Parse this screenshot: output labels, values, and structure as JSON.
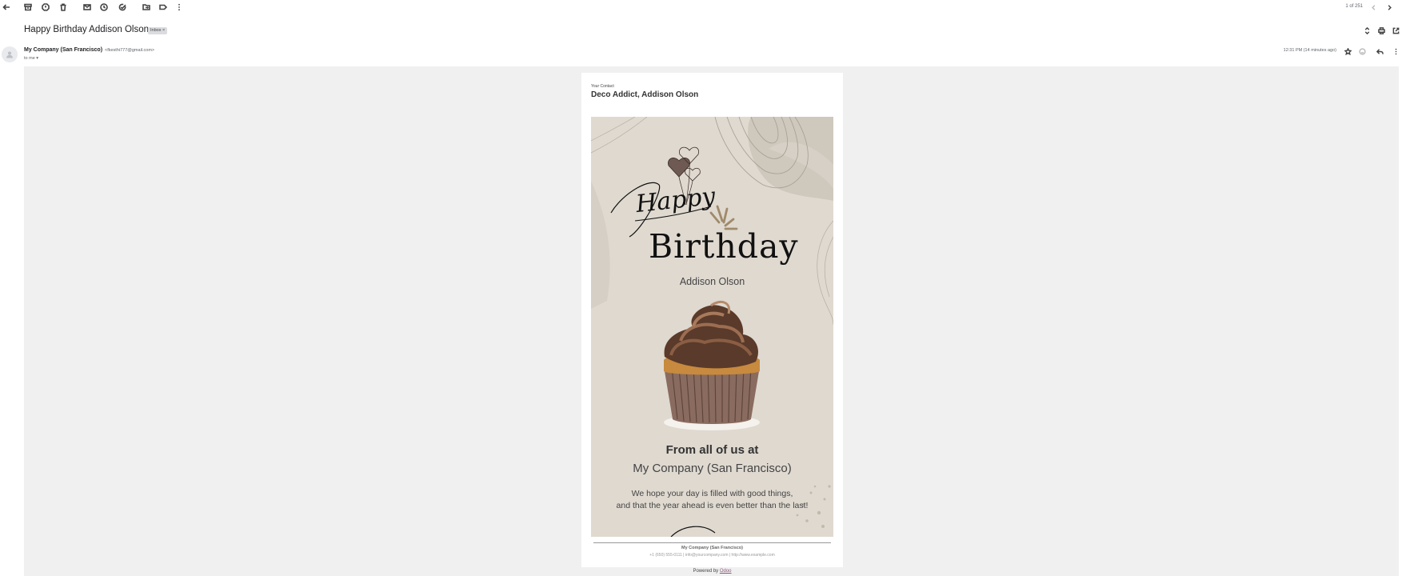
{
  "toolbar": {
    "icons": [
      "back-arrow-icon",
      "archive-icon",
      "report-spam-icon",
      "delete-icon",
      "mark-unread-icon",
      "snooze-icon",
      "add-task-icon",
      "move-to-icon",
      "label-icon",
      "more-vert-icon"
    ],
    "pager_text": "1 of 251"
  },
  "message": {
    "subject": "Happy Birthday Addison Olson",
    "label": "Inbox ×",
    "sender_name": "My Company (San Francisco)",
    "sender_email": "<fkesthi777@gmail.com>",
    "recipient": "to me ▾",
    "timestamp": "12:31 PM (14 minutes ago)"
  },
  "email": {
    "your_contact_label": "Your Contact",
    "contact_name": "Deco Addict, Addison Olson",
    "hero_happy": "Happy",
    "hero_birthday": "Birthday",
    "hero_name": "Addison Olson",
    "from_line": "From all of us at",
    "company_line": "My Company (San Francisco)",
    "message_line_1": "We hope your day is filled with good things,",
    "message_line_2": "and that the year ahead is even better than the last!",
    "footer_company": "My Company (San Francisco)",
    "footer_contact": "+1 (650) 555-0111 | info@yourcompany.com | http://www.example.com",
    "powered_by": "Powered by ",
    "powered_link": "Odoo"
  },
  "colors": {
    "hero_background": "#dfd9d0",
    "mail_background": "#f0f0f0",
    "link": "#875a7b"
  }
}
